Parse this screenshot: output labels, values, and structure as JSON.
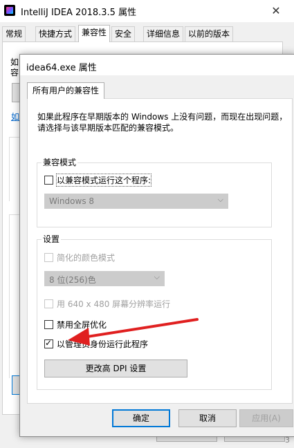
{
  "background_window": {
    "title": "IntelliJ IDEA 2018.3.5 属性",
    "close_glyph": "✕",
    "tabs": [
      "常规",
      "快捷方式",
      "兼容性",
      "安全",
      "详细信息",
      "以前的版本"
    ],
    "active_tab": "兼容性",
    "fragment_1": "如",
    "fragment_2": "容",
    "fragment_link": "如",
    "fragment_bottom": "3"
  },
  "dialog": {
    "title": "idea64.exe 属性",
    "tab_label": "所有用户的兼容性",
    "intro_line1": "如果此程序在早期版本的 Windows 上没有问题，而现在出现问题，",
    "intro_line2": "请选择与该早期版本匹配的兼容模式。",
    "compat_group": {
      "label": "兼容模式",
      "run_in_compat_label": "以兼容模式运行这个程序:",
      "run_in_compat_checked": false,
      "os_select_value": "Windows 8",
      "os_select_enabled": false
    },
    "settings_group": {
      "label": "设置",
      "reduced_color_label": "简化的颜色模式",
      "reduced_color_enabled": false,
      "color_depth_value": "8 位(256)色",
      "res_640_label": "用 640 x 480 屏幕分辨率运行",
      "res_640_enabled": false,
      "disable_fullscreen_opt_label": "禁用全屏优化",
      "disable_fullscreen_opt_checked": false,
      "run_as_admin_label": "以管理员身份运行此程序",
      "run_as_admin_checked": true,
      "dpi_button_label": "更改高 DPI 设置"
    },
    "buttons": {
      "ok": "确定",
      "cancel": "取消",
      "apply": "应用(A)"
    },
    "annotation_color": "#e02020"
  }
}
